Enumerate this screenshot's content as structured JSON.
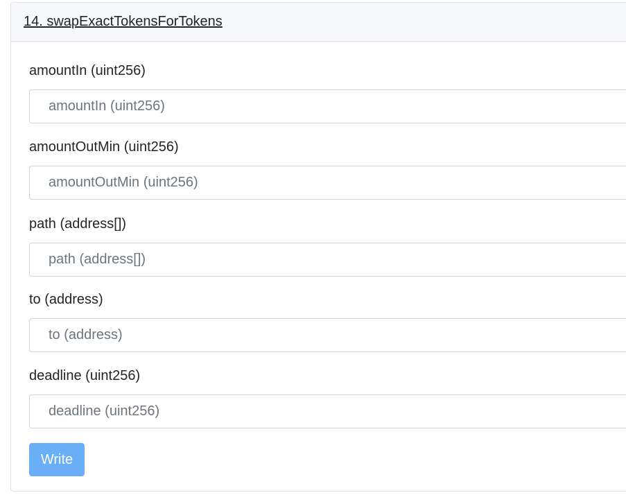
{
  "method": {
    "title": "14. swapExactTokensForTokens"
  },
  "fields": [
    {
      "label": "amountIn (uint256)",
      "placeholder": "amountIn (uint256)",
      "value": ""
    },
    {
      "label": "amountOutMin (uint256)",
      "placeholder": "amountOutMin (uint256)",
      "value": ""
    },
    {
      "label": "path (address[])",
      "placeholder": "path (address[])",
      "value": ""
    },
    {
      "label": "to (address)",
      "placeholder": "to (address)",
      "value": ""
    },
    {
      "label": "deadline (uint256)",
      "placeholder": "deadline (uint256)",
      "value": ""
    }
  ],
  "actions": {
    "write_label": "Write"
  },
  "colors": {
    "button_bg": "#6aaef8",
    "header_bg": "#f8f9fa",
    "border": "#dfe2e6"
  }
}
